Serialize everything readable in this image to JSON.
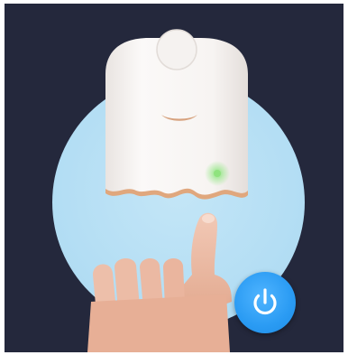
{
  "screen": {
    "background_color": "#24283c",
    "circle_color": "#b4def4",
    "device_color": "#f7f4f2",
    "indicator_led_color": "#7be06a",
    "accent_color": "#2a9bf3"
  },
  "device": {
    "indicator": "status-led",
    "state": "on"
  },
  "power_button": {
    "icon": "power-icon"
  }
}
